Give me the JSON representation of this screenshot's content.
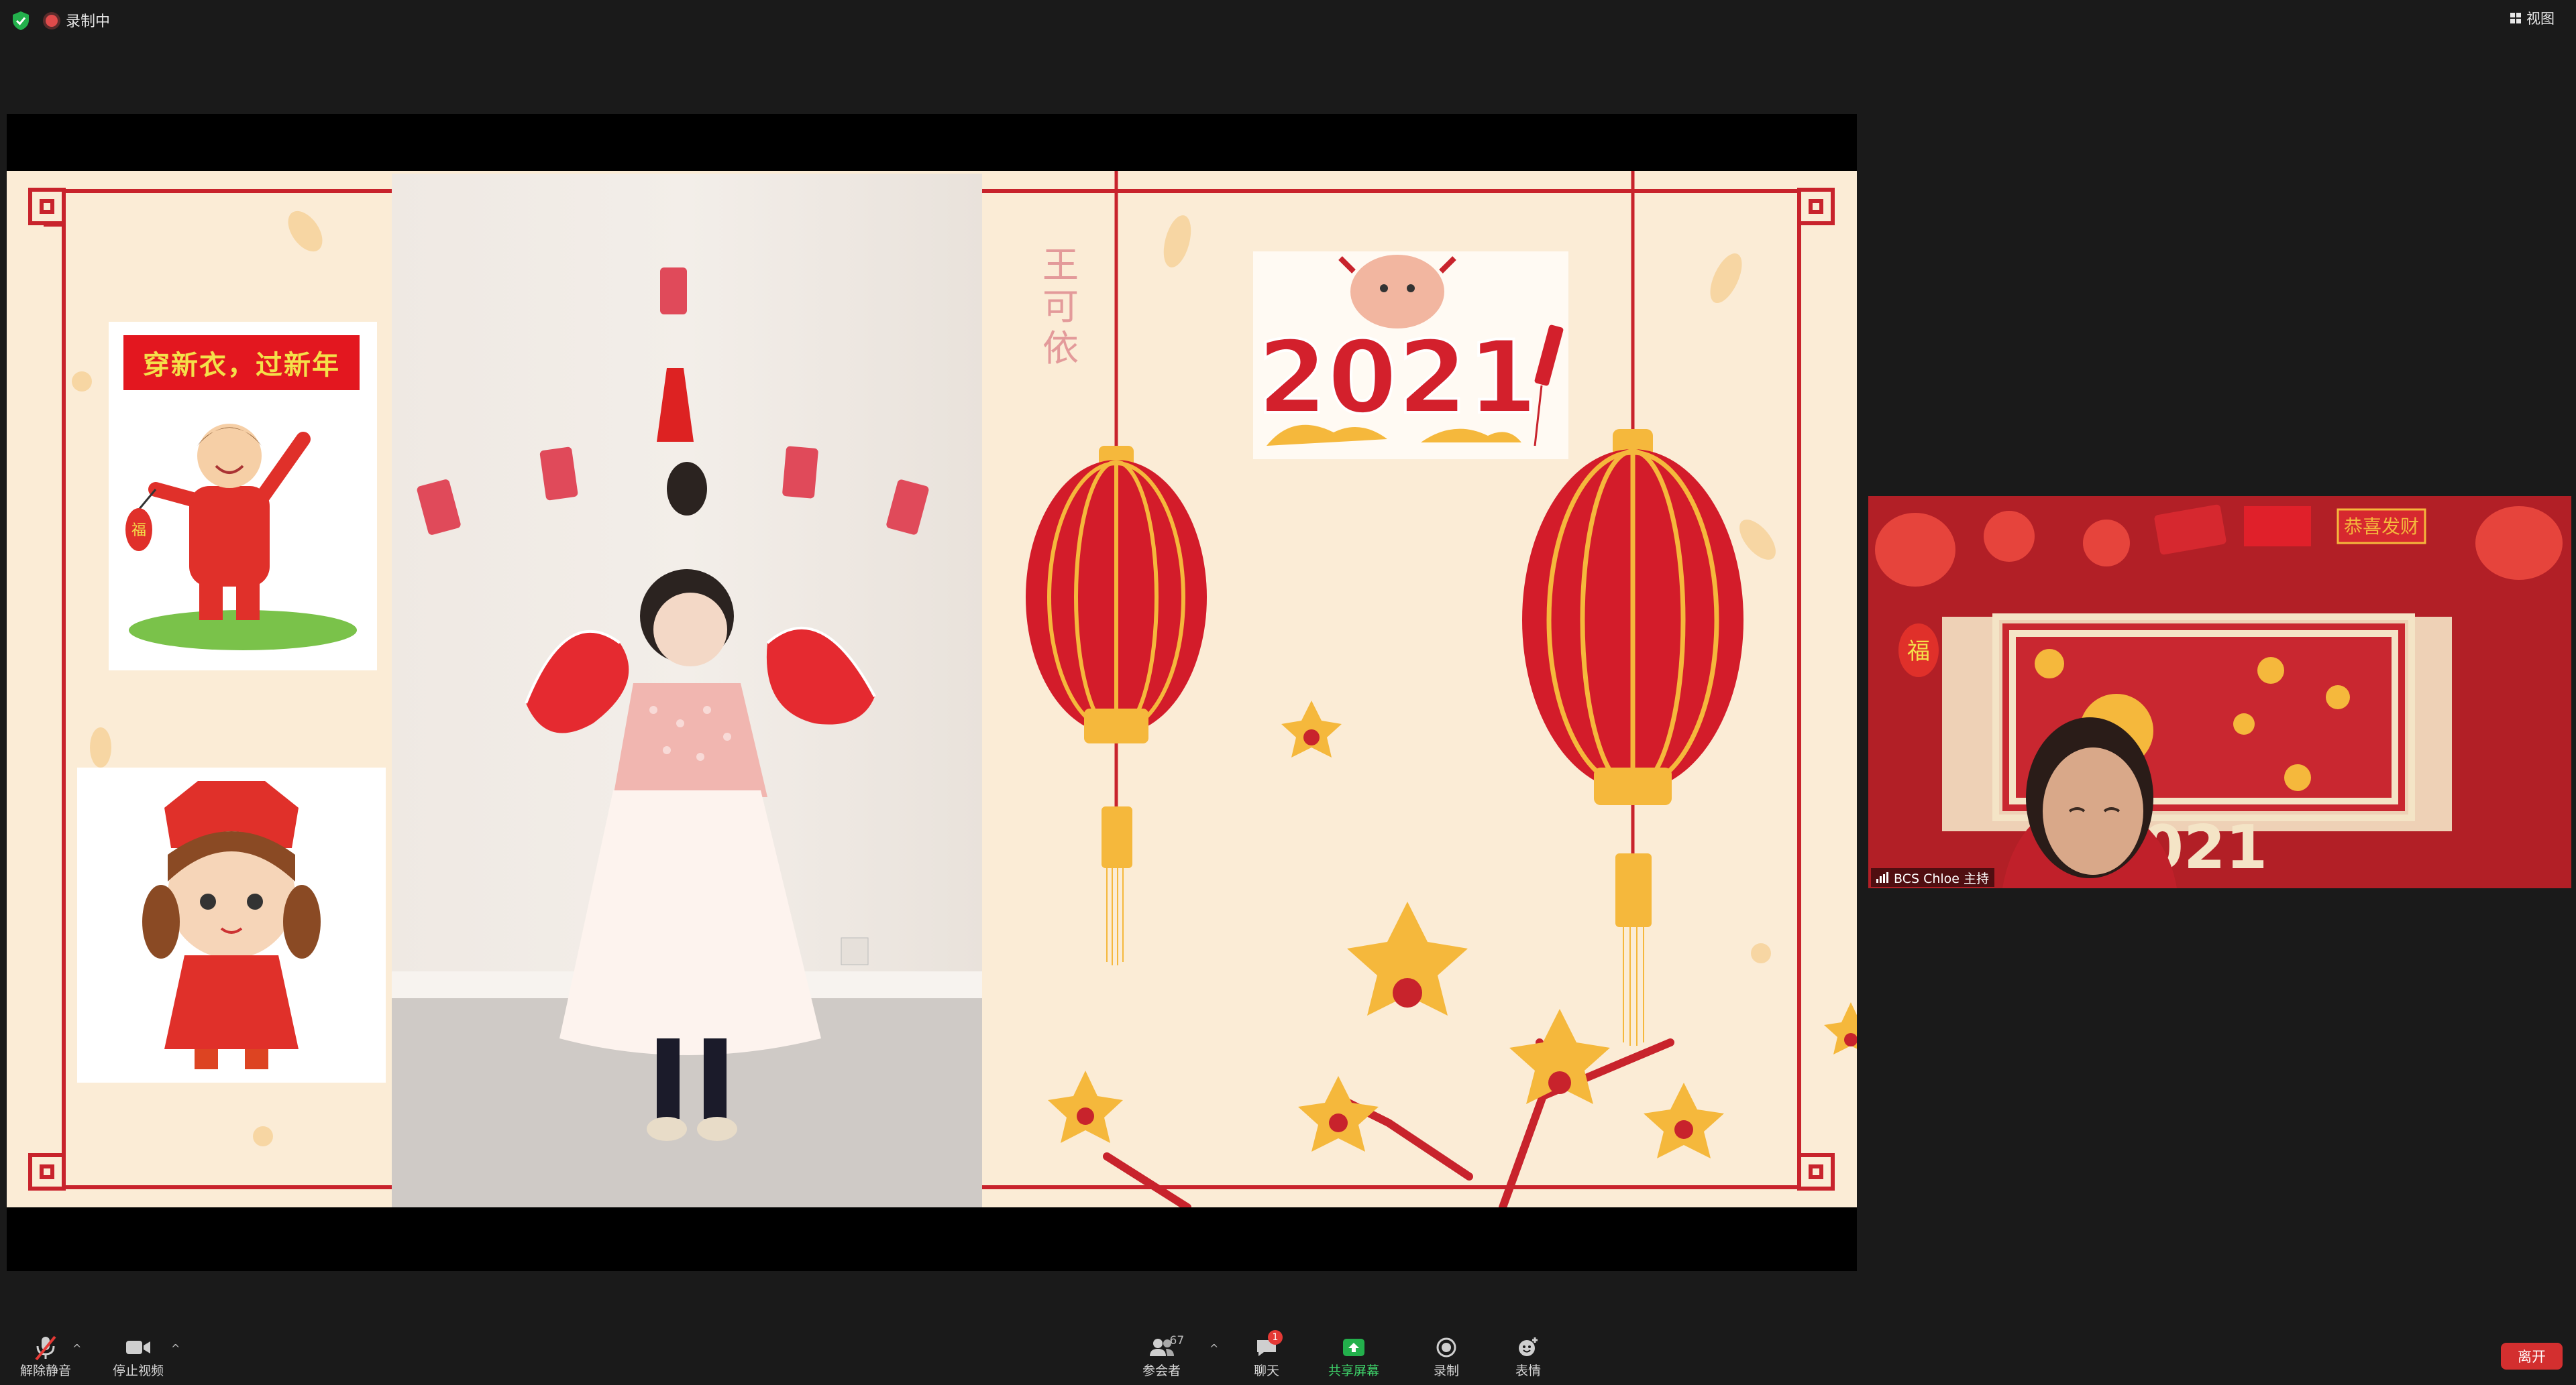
{
  "top_bar": {
    "recording_label": "录制中",
    "view_label": "视图"
  },
  "slide": {
    "name_chars": [
      "王",
      "可",
      "依"
    ],
    "banner_text": "穿新衣，过新年",
    "sticker_year": "2021"
  },
  "participant": {
    "name_label": "BCS Chloe 主持",
    "backdrop_year": "2021",
    "backdrop_sign": "恭喜发财",
    "fu_char": "福"
  },
  "toolbar": {
    "unmute_label": "解除静音",
    "stop_video_label": "停止视频",
    "participants_label": "参会者",
    "participants_count": "67",
    "chat_label": "聊天",
    "chat_badge": "1",
    "share_label": "共享屏幕",
    "record_label": "录制",
    "reactions_label": "表情",
    "leave_label": "离开"
  },
  "colors": {
    "accent_red": "#d32f2f",
    "share_green": "#3ed36a",
    "slide_bg": "#fbecd6",
    "frame_red": "#c8232c",
    "lantern_gold": "#f5b83c"
  }
}
